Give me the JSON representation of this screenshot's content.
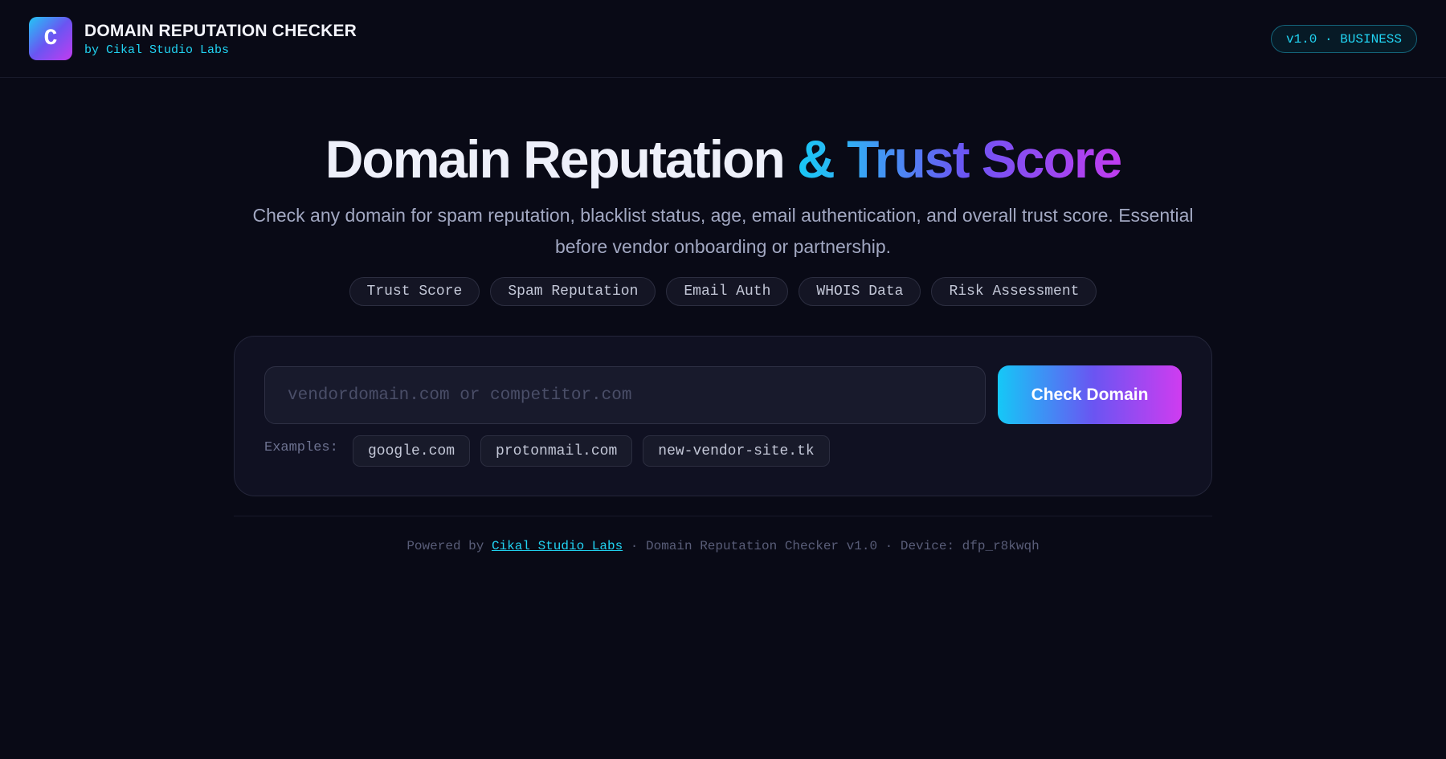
{
  "header": {
    "logo_letter": "C",
    "title": "DOMAIN REPUTATION CHECKER",
    "subtitle": "by Cikal Studio Labs",
    "badge": "v1.0 · BUSINESS"
  },
  "hero": {
    "title_part1": "Domain Reputation ",
    "title_part2": "& Trust Score",
    "description": "Check any domain for spam reputation, blacklist status, age, email authentication, and overall trust score. Essential before vendor onboarding or partnership."
  },
  "tags": [
    "Trust Score",
    "Spam Reputation",
    "Email Auth",
    "WHOIS Data",
    "Risk Assessment"
  ],
  "search": {
    "value": "",
    "placeholder": "vendordomain.com or competitor.com",
    "button_label": "Check Domain",
    "examples_label": "Examples:",
    "examples": [
      "google.com",
      "protonmail.com",
      "new-vendor-site.tk"
    ]
  },
  "footer": {
    "powered_by": "Powered by ",
    "link_text": "Cikal Studio Labs",
    "rest": " · Domain Reputation Checker v1.0 · Device: dfp_r8kwqh"
  },
  "colors": {
    "background": "#090a16",
    "accent_cyan": "#21d3f2",
    "accent_purple": "#6a55f2",
    "accent_magenta": "#c23cf0"
  }
}
